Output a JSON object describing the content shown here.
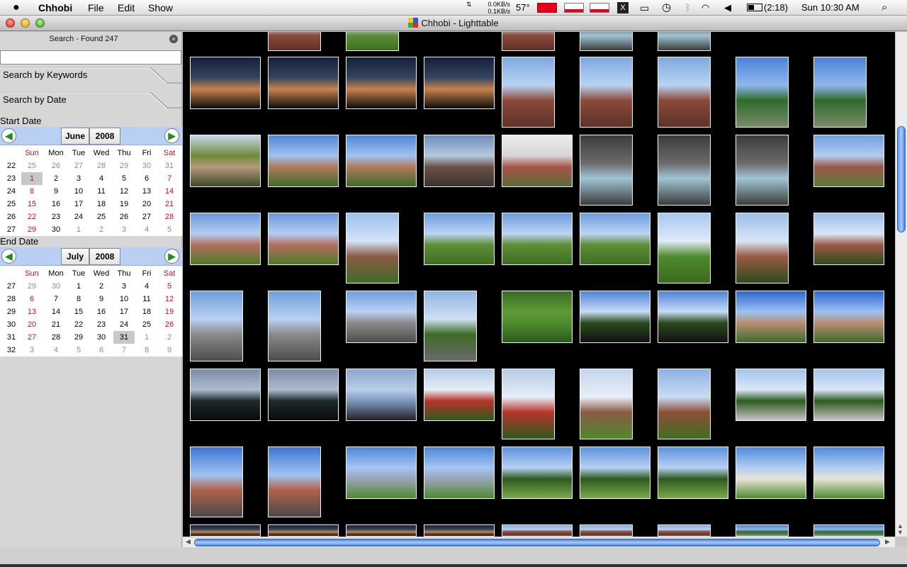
{
  "menubar": {
    "app": "Chhobi",
    "menus": [
      "File",
      "Edit",
      "Show"
    ],
    "network": {
      "down": "0.0KB/s",
      "up": "0.1KB/s"
    },
    "temperature": "57°",
    "battery": "(2:18)",
    "datetime": "Sun 10:30 AM"
  },
  "window": {
    "title": "Chhobi - Lighttable"
  },
  "sidebar": {
    "search_title": "Search - Found 247",
    "search_value": "",
    "tab_keywords": "Search by Keywords",
    "tab_date": "Search by Date",
    "start_label": "Start Date",
    "end_label": "End Date",
    "weekdays": [
      "Sun",
      "Mon",
      "Tue",
      "Wed",
      "Thu",
      "Fri",
      "Sat"
    ],
    "start_calendar": {
      "month": "June",
      "year": "2008",
      "rows": [
        {
          "week": "22",
          "days": [
            "25",
            "26",
            "27",
            "28",
            "29",
            "30",
            "31"
          ]
        },
        {
          "week": "23",
          "days": [
            "1",
            "2",
            "3",
            "4",
            "5",
            "6",
            "7"
          ]
        },
        {
          "week": "24",
          "days": [
            "8",
            "9",
            "10",
            "11",
            "12",
            "13",
            "14"
          ]
        },
        {
          "week": "25",
          "days": [
            "15",
            "16",
            "17",
            "18",
            "19",
            "20",
            "21"
          ]
        },
        {
          "week": "26",
          "days": [
            "22",
            "23",
            "24",
            "25",
            "26",
            "27",
            "28"
          ]
        },
        {
          "week": "27",
          "days": [
            "29",
            "30",
            "1",
            "2",
            "3",
            "4",
            "5"
          ]
        }
      ],
      "selected": "1"
    },
    "end_calendar": {
      "month": "July",
      "year": "2008",
      "rows": [
        {
          "week": "27",
          "days": [
            "29",
            "30",
            "1",
            "2",
            "3",
            "4",
            "5"
          ]
        },
        {
          "week": "28",
          "days": [
            "6",
            "7",
            "8",
            "9",
            "10",
            "11",
            "12"
          ]
        },
        {
          "week": "29",
          "days": [
            "13",
            "14",
            "15",
            "16",
            "17",
            "18",
            "19"
          ]
        },
        {
          "week": "30",
          "days": [
            "20",
            "21",
            "22",
            "23",
            "24",
            "25",
            "26"
          ]
        },
        {
          "week": "31",
          "days": [
            "27",
            "28",
            "29",
            "30",
            "31",
            "1",
            "2"
          ]
        },
        {
          "week": "32",
          "days": [
            "3",
            "4",
            "5",
            "6",
            "7",
            "8",
            "9"
          ]
        }
      ],
      "selected": "31"
    }
  },
  "lighttable": {
    "photo_count": 74,
    "photos": [
      "dusk skyline",
      "dusk skyline",
      "dusk skyline",
      "dusk skyline",
      "brick tower",
      "brick tower",
      "brick tower",
      "palm tree",
      "palm tree",
      "tree and building",
      "campus building",
      "campus building",
      "courtyard",
      "gazebo",
      "fountain",
      "fountain",
      "fountain",
      "brick building",
      "dorm lawn",
      "dorm lawn",
      "palm walkway",
      "garden lawn",
      "garden lawn",
      "garden lawn",
      "lawn trees",
      "clock tower",
      "clock tower",
      "street",
      "street",
      "street",
      "garden path",
      "green lawn",
      "tree canopy",
      "tree canopy",
      "arcade building",
      "arcade building",
      "tree silhouette",
      "tree silhouette",
      "sky",
      "memorial flag",
      "memorial flag",
      "lamp path",
      "brick wall",
      "shaded path",
      "shaded path",
      "brick apartments",
      "brick apartments",
      "modern building",
      "modern building",
      "park lawn",
      "park lawn",
      "park lawn",
      "domed hall",
      "domed hall"
    ]
  }
}
